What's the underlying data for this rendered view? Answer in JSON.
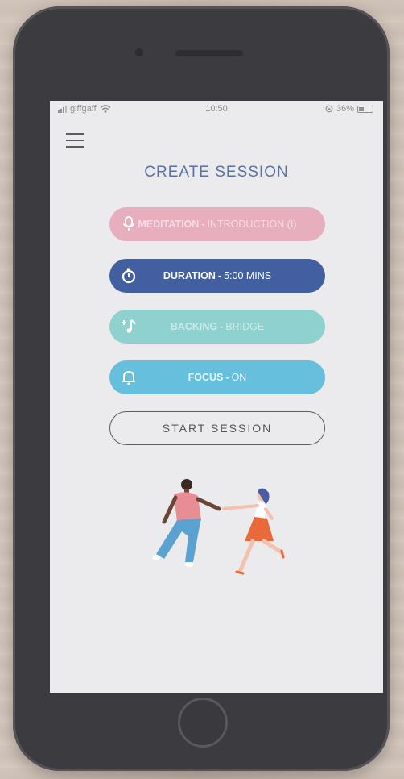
{
  "status_bar": {
    "carrier": "giffgaff",
    "time": "10:50",
    "battery": "36%"
  },
  "screen": {
    "title": "CREATE SESSION",
    "options": [
      {
        "label": "MEDITATION",
        "separator": "-",
        "value": "INTRODUCTION (I)",
        "icon": "microphone-icon",
        "color": "#e7aebe"
      },
      {
        "label": "DURATION",
        "separator": "-",
        "value": "5:00 MINS",
        "icon": "stopwatch-icon",
        "color": "#42609f"
      },
      {
        "label": "BACKING",
        "separator": "-",
        "value": "BRIDGE",
        "icon": "music-note-icon",
        "color": "#8fd1cf"
      },
      {
        "label": "FOCUS",
        "separator": "-",
        "value": "ON",
        "icon": "bell-icon",
        "color": "#66bfdc"
      }
    ],
    "start_button": "START SESSION"
  }
}
